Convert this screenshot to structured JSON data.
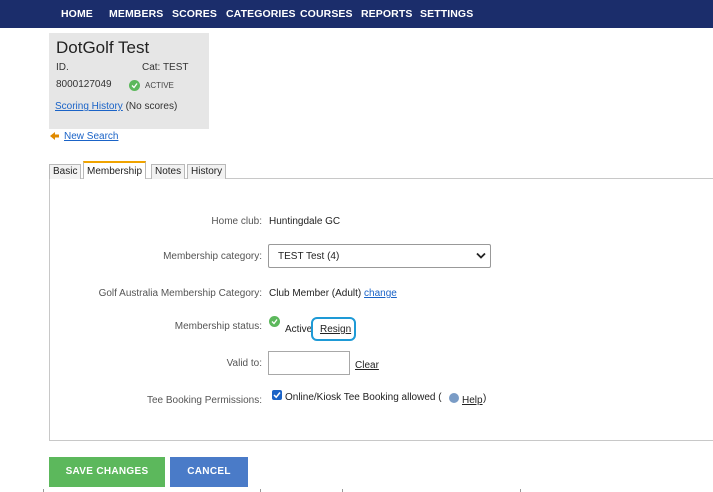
{
  "nav": {
    "items": [
      {
        "label": "HOME"
      },
      {
        "label": "MEMBERS"
      },
      {
        "label": "SCORES"
      },
      {
        "label": "CATEGORIES"
      },
      {
        "label": "COURSES"
      },
      {
        "label": "REPORTS"
      },
      {
        "label": "SETTINGS"
      }
    ],
    "active": "MEMBERS"
  },
  "member": {
    "name": "DotGolf Test",
    "id_label": "ID.",
    "id_value": "8000127049",
    "cat_label": "Cat: TEST",
    "status_badge": "ACTIVE",
    "scoring_history_link": "Scoring History",
    "scoring_history_note": "(No scores)"
  },
  "back_link": "New Search",
  "tabs": [
    {
      "label": "Basic"
    },
    {
      "label": "Membership"
    },
    {
      "label": "Notes"
    },
    {
      "label": "History"
    }
  ],
  "form": {
    "home_club_label": "Home club:",
    "home_club_value": "Huntingdale GC",
    "membership_category_label": "Membership category:",
    "membership_category_value": "TEST Test (4)",
    "ga_category_label": "Golf Australia Membership Category:",
    "ga_category_value": "Club Member (Adult)",
    "ga_change_link": "change",
    "status_label": "Membership status:",
    "status_value": "Active",
    "resign_link": "Resign",
    "valid_to_label": "Valid to:",
    "valid_to_value": "",
    "clear_link": "Clear",
    "tee_label": "Tee Booking Permissions:",
    "tee_checkbox_label": "Online/Kiosk Tee Booking allowed (",
    "help_link": "Help",
    "tee_close_paren": ")"
  },
  "buttons": {
    "save": "SAVE CHANGES",
    "cancel": "CANCEL"
  },
  "colors": {
    "navbar": "#1b2d6b",
    "save_button": "#5cb85c",
    "cancel_button": "#4a7bc8",
    "link": "#1a63c7",
    "active_tab_accent": "#f0a400",
    "highlight": "#1e9ad6"
  }
}
